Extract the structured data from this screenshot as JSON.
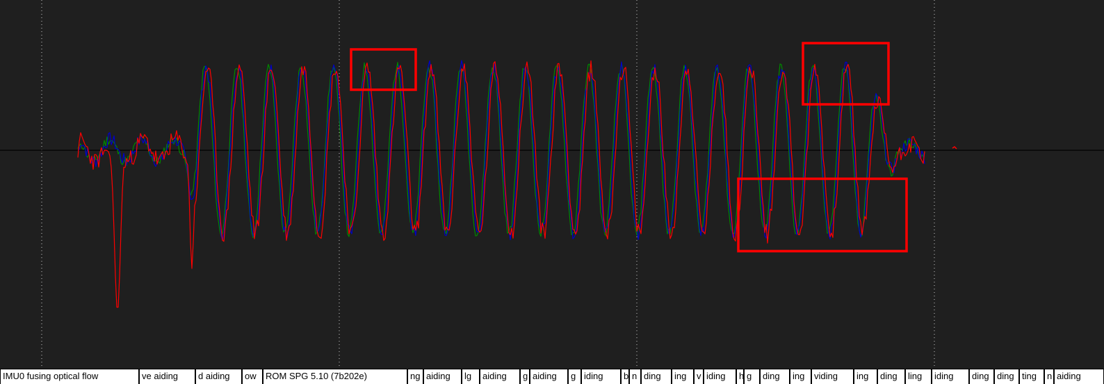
{
  "chart_data": {
    "type": "line",
    "title": "",
    "xlabel": "",
    "ylabel": "",
    "grid": true,
    "zero_line": true,
    "series": [
      {
        "color": "#0000cc",
        "values": []
      },
      {
        "color": "#008800",
        "values": []
      },
      {
        "color": "#ff0000",
        "values": []
      }
    ]
  },
  "highlight_color": "#ff0000",
  "highlight_boxes": 3,
  "message_bar": {
    "messages": [
      "IMU0 fusing optical flow",
      "ve aiding",
      "d aiding",
      "ow",
      "ROM SPG 5.10 (7b202e)",
      "ng",
      "aiding",
      "lg",
      "aiding",
      "g",
      "aiding",
      "g",
      "iding",
      "b",
      "n",
      "ding",
      "ing",
      "v",
      "iding",
      "h",
      "g",
      "ding",
      "ing",
      "viding",
      "ing",
      "ding",
      "ling",
      "iding",
      "ding",
      "ding",
      "ting",
      "n",
      "aiding"
    ]
  }
}
